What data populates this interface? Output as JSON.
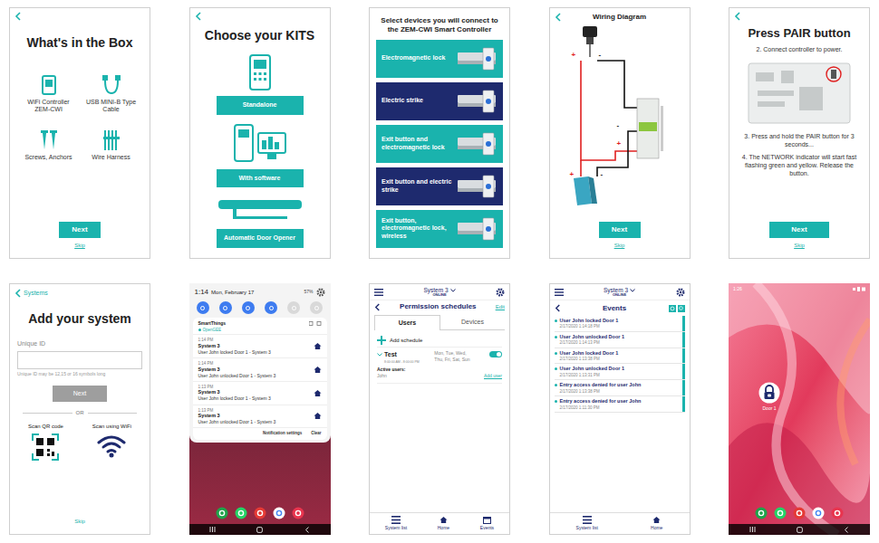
{
  "box_screen": {
    "title": "What's in the Box",
    "items": [
      {
        "label": "WiFi Controller ZEM-CWI"
      },
      {
        "label": "USB MINI-B Type Cable"
      },
      {
        "label": "Screws, Anchors"
      },
      {
        "label": "Wire Harness"
      }
    ],
    "next_button": "Next",
    "skip_link": "Skip"
  },
  "kits_screen": {
    "title": "Choose your KITS",
    "options": [
      {
        "label": "Standalone"
      },
      {
        "label": "With software"
      },
      {
        "label": "Automatic Door Opener"
      }
    ]
  },
  "devices_screen": {
    "title": "Select devices you will connect to the ZEM-CWI Smart Controller",
    "devices": [
      {
        "label": "Electromagnetic lock",
        "color": "#1ab3ad"
      },
      {
        "label": "Electric strike",
        "color": "#1e2a6e"
      },
      {
        "label": "Exit button and electromagnetic lock",
        "color": "#1ab3ad"
      },
      {
        "label": "Exit button and electric strike",
        "color": "#1e2a6e"
      },
      {
        "label": "Exit button, electromagnetic lock, wireless",
        "color": "#1ab3ad"
      }
    ]
  },
  "wiring_screen": {
    "title": "Wiring Diagram",
    "terminals": [
      "+",
      "-",
      "-",
      "+",
      "+",
      "-"
    ],
    "next_button": "Next",
    "skip_link": "Skip"
  },
  "pair_screen": {
    "title": "Press PAIR button",
    "steps": [
      "2. Connect controller to power.",
      "3. Press and hold the  PAIR button for 3 seconds...",
      "4. The NETWORK indicator will start fast flashing green and yellow. Release the button."
    ],
    "next_button": "Next",
    "skip_link": "Skip"
  },
  "add_system_screen": {
    "back_link": "Systems",
    "title": "Add your system",
    "field_label": "Unique ID",
    "field_hint": "Unique ID may be 12,15 or 16 symbols long",
    "next_button": {
      "label": "Next",
      "disabled": true
    },
    "separator": "OR",
    "scan_options": [
      {
        "label": "Scan QR code"
      },
      {
        "label": "Scan using WiFi"
      }
    ],
    "skip_link": "Skip"
  },
  "notifications_screen": {
    "time": "1:14",
    "date": "Mon, February 17",
    "battery": "57%",
    "quick_toggles": [
      {
        "on": true
      },
      {
        "on": true
      },
      {
        "on": true
      },
      {
        "on": true
      },
      {
        "on": false
      },
      {
        "on": false
      }
    ],
    "app": "SmartThings",
    "channel": "OpenGEE",
    "notifications": [
      {
        "time": "1:14 PM",
        "title": "System 3",
        "message": "User John locked Door 1 - System 3"
      },
      {
        "time": "1:14 PM",
        "title": "System 3",
        "message": "User John unlocked Door 1 - System 3"
      },
      {
        "time": "1:13 PM",
        "title": "System 3",
        "message": "User John locked Door 1 - System 3"
      },
      {
        "time": "1:13 PM",
        "title": "System 3",
        "message": "User John unlocked Door 1 - System 3"
      }
    ],
    "settings_link": "Notification settings",
    "clear_button": "Clear"
  },
  "permissions_screen": {
    "system": "System 3",
    "status": "ONLINE",
    "title": "Permission schedules",
    "edit_link": "Edit",
    "tabs": [
      {
        "label": "Users",
        "selected": true
      },
      {
        "label": "Devices",
        "selected": false
      }
    ],
    "add_button": "Add schedule",
    "schedules": [
      {
        "name": "Test",
        "time": "8:00:00 AM - 8:00:00 PM",
        "days": "Mon, Tue, Wed, Thu, Fri, Sat, Sun",
        "on": true,
        "active_users_label": "Active users:",
        "users": "John",
        "add_user_link": "Add user"
      }
    ],
    "nav": [
      {
        "label": "System list"
      },
      {
        "label": "Home"
      },
      {
        "label": "Events"
      }
    ]
  },
  "events_screen": {
    "system": "System 3",
    "status": "ONLINE",
    "title": "Events",
    "events": [
      {
        "text": "User John locked Door 1",
        "date": "2/17/2020 1:14:18 PM"
      },
      {
        "text": "User John unlocked Door 1",
        "date": "2/17/2020 1:14:13 PM"
      },
      {
        "text": "User John locked Door 1",
        "date": "2/17/2020 1:13:38 PM"
      },
      {
        "text": "User John unlocked Door 1",
        "date": "2/17/2020 1:13:31 PM"
      },
      {
        "text": "Entry access denied for user John",
        "date": "2/17/2020 1:13:38 PM"
      },
      {
        "text": "Entry access denied for user John",
        "date": "2/17/2020 1:11:30 PM"
      }
    ],
    "nav": [
      {
        "label": "System list"
      },
      {
        "label": "Home"
      }
    ]
  },
  "home_screen": {
    "time": "1:26",
    "widget_label": "Door 1"
  }
}
